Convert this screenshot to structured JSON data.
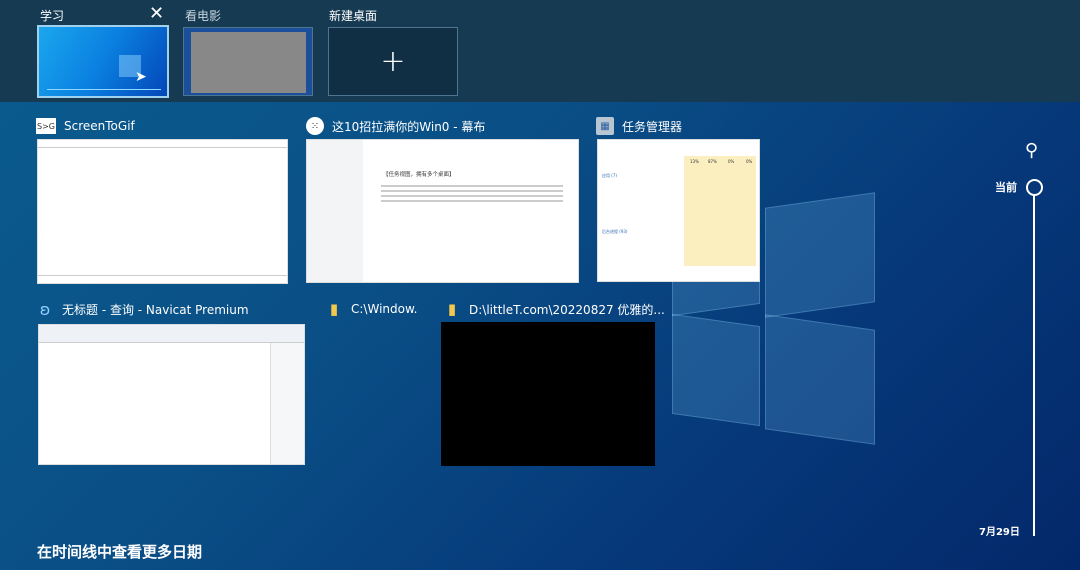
{
  "desktops": [
    {
      "label": "学习",
      "active": true
    },
    {
      "label": "看电影",
      "active": false
    },
    {
      "label": "新建桌面",
      "active": false
    }
  ],
  "windows": [
    {
      "title": "ScreenToGif",
      "icon": "screentogif-icon"
    },
    {
      "title": "这10招拉满你的Win0 - 幕布",
      "icon": "mubu-icon"
    },
    {
      "title": "任务管理器",
      "icon": "task-manager-icon"
    },
    {
      "title": "无标题 - 查询 - Navicat Premium",
      "icon": "navicat-icon"
    },
    {
      "title": "C:\\Window.",
      "icon": "folder-icon"
    },
    {
      "title": "D:\\littleT.com\\20220827 优雅的...",
      "icon": "folder-icon"
    }
  ],
  "timeline": {
    "current_label": "当前",
    "date_label": "7月29日",
    "more_dates": "在时间线中查看更多日期"
  },
  "mubu": {
    "heading": "【任务视图，拥有多个桌面】"
  },
  "taskmgr": {
    "cpu": "13%",
    "mem": "87%",
    "disk": "0%",
    "net": "0%",
    "group1": "应用 (7)",
    "group2": "后台进程 (93)"
  }
}
